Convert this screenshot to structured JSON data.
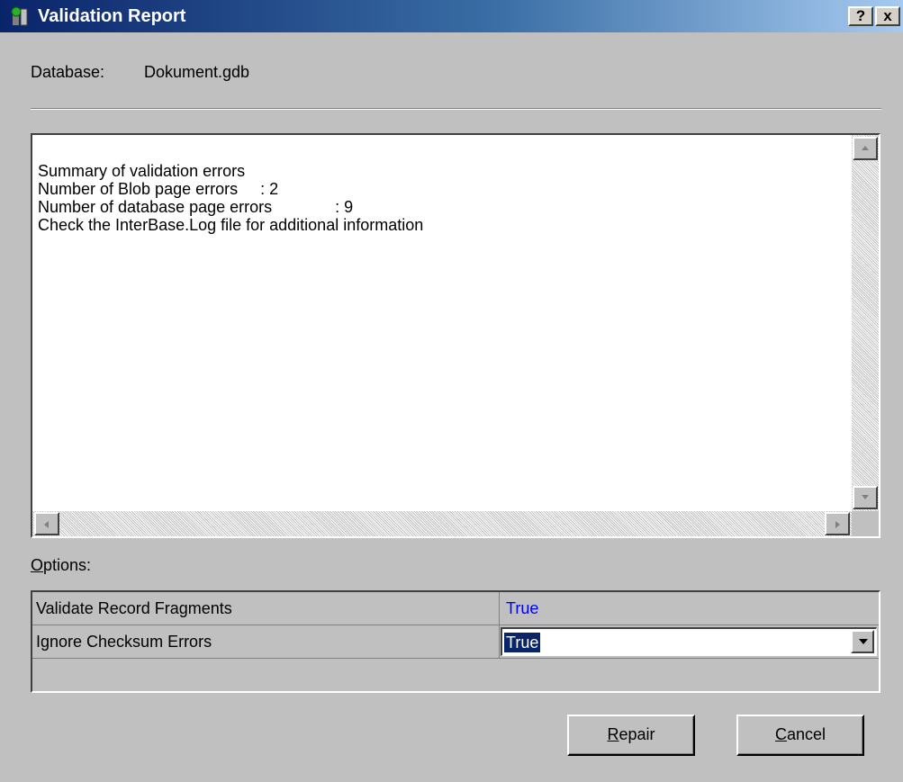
{
  "window": {
    "title": "Validation Report",
    "help_glyph": "?",
    "close_glyph": "x"
  },
  "database": {
    "label": "Database:",
    "value": "Dokument.gdb"
  },
  "report": {
    "lines": [
      "Summary of validation errors",
      "",
      "Number of Blob page errors     : 2",
      "Number of database page errors              : 9",
      "",
      "Check the InterBase.Log file for additional information"
    ]
  },
  "options": {
    "label_hotkey": "O",
    "label_rest": "ptions:",
    "rows": [
      {
        "name": "Validate Record Fragments",
        "value": "True"
      },
      {
        "name": "Ignore Checksum Errors",
        "value": "True"
      }
    ]
  },
  "buttons": {
    "repair_hotkey": "R",
    "repair_rest": "epair",
    "cancel_hotkey": "C",
    "cancel_rest": "ancel"
  },
  "colors": {
    "title_bar": "#0a246a",
    "value_text": "#0000ff",
    "selection": "#0a246a",
    "face": "#c0c0c0"
  }
}
